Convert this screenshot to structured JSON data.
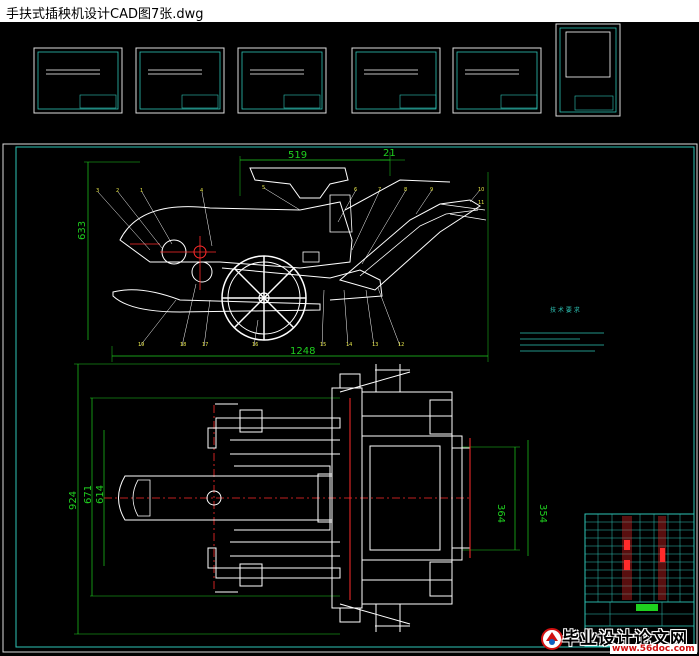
{
  "window": {
    "title": "手扶式插秧机设计CAD图7张.dwg"
  },
  "colors": {
    "background": "#000000",
    "frame": "#2ec4b6",
    "lines": "#ffffff",
    "dimension": "#1fd11f",
    "centerline": "#ff2b2b",
    "outline": "#e8e84a"
  },
  "drawing": {
    "dimensions": {
      "top_width": "519",
      "top_right": "21",
      "left_height": "633",
      "overall_width": "1248",
      "plan_height": "924",
      "plan_inner": "671",
      "plan_inner2": "614",
      "plan_right1": "364",
      "plan_right2": "354"
    },
    "part_labels": [
      "3",
      "2",
      "1",
      "4",
      "5",
      "6",
      "7",
      "8",
      "9",
      "10",
      "11",
      "12",
      "13",
      "14",
      "15",
      "16",
      "17",
      "18",
      "19"
    ],
    "notes_title": "技 术 要 求",
    "notes_count": 3
  },
  "thumbnails": [
    {
      "name": "sheet-1"
    },
    {
      "name": "sheet-2"
    },
    {
      "name": "sheet-3"
    },
    {
      "name": "sheet-4"
    },
    {
      "name": "sheet-5"
    },
    {
      "name": "sheet-6"
    }
  ],
  "watermark": {
    "text": "毕业设计论文网",
    "url": "www.56doc.com"
  }
}
